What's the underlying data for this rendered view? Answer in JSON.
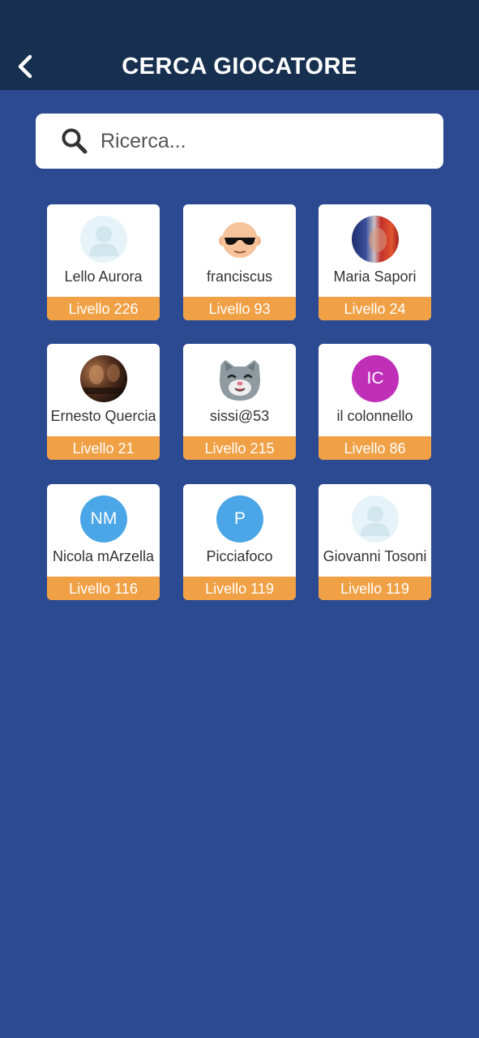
{
  "header": {
    "title": "CERCA GIOCATORE",
    "back_icon": "chevron-left-icon"
  },
  "search": {
    "placeholder": "Ricerca...",
    "value": "",
    "icon": "search-icon"
  },
  "colors": {
    "background": "#2c4a92",
    "topbar": "#17304f",
    "level_bar": "#f0a045"
  },
  "players": [
    {
      "name": "Lello Aurora",
      "level": "Livello 226",
      "avatar": "default-person-avatar"
    },
    {
      "name": "franciscus",
      "level": "Livello 93",
      "avatar": "sunglasses-face-avatar"
    },
    {
      "name": "Maria Sapori",
      "level": "Livello 24",
      "avatar": "photo-avatar"
    },
    {
      "name": "Ernesto Quercia",
      "level": "Livello 21",
      "avatar": "movie-poster-avatar"
    },
    {
      "name": "sissi@53",
      "level": "Livello 215",
      "avatar": "cat-face-avatar"
    },
    {
      "name": "il colonnello",
      "level": "Livello 86",
      "avatar": "initials-avatar",
      "initials": "IC",
      "color": "#c02fb8"
    },
    {
      "name": "Nicola mArzella",
      "level": "Livello 116",
      "avatar": "initials-avatar",
      "initials": "NM",
      "color": "#4aa6e6"
    },
    {
      "name": "Picciafoco",
      "level": "Livello 119",
      "avatar": "initials-avatar",
      "initials": "P",
      "color": "#4aa6e6"
    },
    {
      "name": "Giovanni Tosoni",
      "level": "Livello 119",
      "avatar": "default-person-avatar"
    }
  ]
}
